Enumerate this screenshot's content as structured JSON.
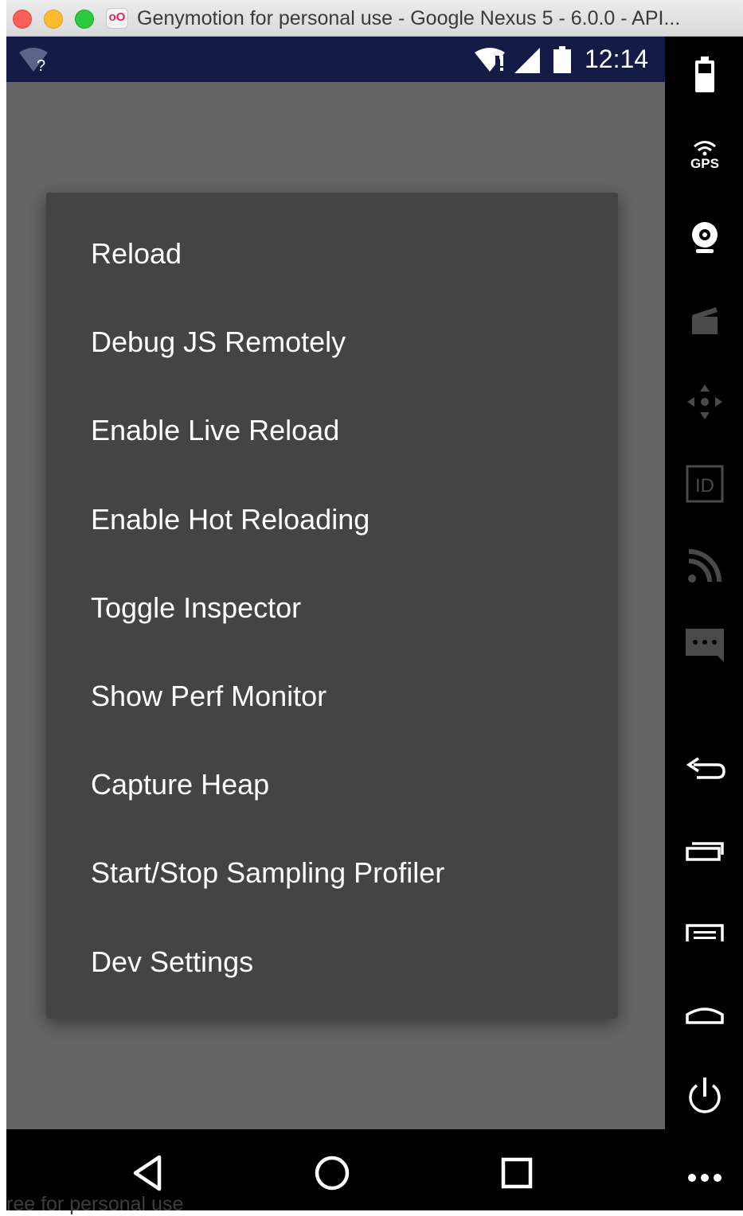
{
  "window": {
    "title": "Genymotion for personal use - Google Nexus 5 - 6.0.0 - API...",
    "app_icon_glyph": "oO"
  },
  "status_bar": {
    "time": "12:14",
    "icons": [
      "wifi-unknown-icon",
      "wifi-alert-icon",
      "signal-icon",
      "battery-icon"
    ]
  },
  "dev_menu": {
    "items": [
      {
        "label": "Reload"
      },
      {
        "label": "Debug JS Remotely"
      },
      {
        "label": "Enable Live Reload"
      },
      {
        "label": "Enable Hot Reloading"
      },
      {
        "label": "Toggle Inspector"
      },
      {
        "label": "Show Perf Monitor"
      },
      {
        "label": "Capture Heap"
      },
      {
        "label": "Start/Stop Sampling Profiler"
      },
      {
        "label": "Dev Settings"
      }
    ]
  },
  "nav_bar": {
    "buttons": [
      "back-icon",
      "home-icon",
      "recents-icon"
    ],
    "watermark": "ree for personal use"
  },
  "sidebar": {
    "gps_label": "GPS",
    "id_label": "ID",
    "buttons": [
      "battery-widget-icon",
      "gps-icon",
      "webcam-icon",
      "capture-icon",
      "dpad-icon",
      "device-id-icon",
      "network-icon",
      "sms-icon",
      "back-icon",
      "recent-apps-icon",
      "menu-icon",
      "home-icon",
      "power-icon",
      "more-icon"
    ]
  },
  "colors": {
    "status_bar": "#141b47",
    "screen_background": "#656565",
    "menu_background": "#444444",
    "menu_text": "#ffffff",
    "toolbar_background": "#000000"
  }
}
